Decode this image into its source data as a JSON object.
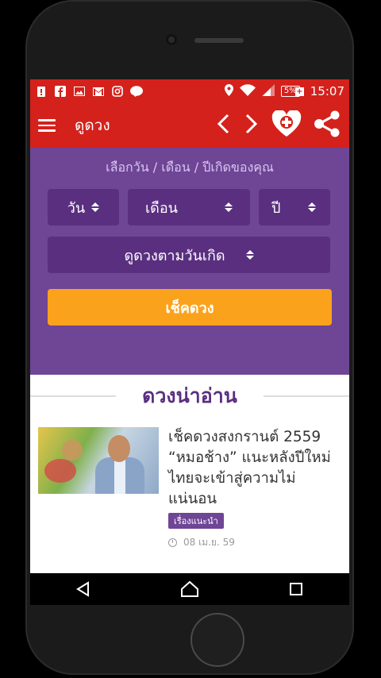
{
  "status_bar": {
    "time": "15:07",
    "battery": "5%",
    "notification_icons": [
      "warning-icon",
      "facebook-icon",
      "image-icon",
      "gmail-icon",
      "instagram-icon",
      "line-icon"
    ],
    "system_icons": [
      "location-icon",
      "wifi-icon",
      "signal-icon",
      "battery-icon"
    ]
  },
  "app_bar": {
    "title": "ดูดวง",
    "icons": [
      "menu-icon",
      "chevron-left-icon",
      "chevron-right-icon",
      "heart-plus-icon",
      "share-icon"
    ],
    "accent": "#d4211c"
  },
  "form": {
    "caption": "เลือกวัน / เดือน / ปีเกิดของคุณ",
    "day_label": "วัน",
    "month_label": "เดือน",
    "year_label": "ปี",
    "mode_label": "ดูดวงตามวันเกิด",
    "submit_label": "เช็คดวง",
    "panel_color": "#6f4596",
    "button_color": "#fba21c"
  },
  "section": {
    "title": "ดวงน่าอ่าน"
  },
  "articles": [
    {
      "title": "เช็คดวงสงกรานต์ 2559 “หมอช้าง” แนะหลังปีใหม่ไทยจะเข้าสู่ความไม่แน่นอน",
      "tag": "เรื่องแนะนำ",
      "date": "08 เม.ย. 59"
    }
  ],
  "nav_bar": {
    "icons": [
      "back-icon",
      "home-icon",
      "recents-icon"
    ]
  }
}
